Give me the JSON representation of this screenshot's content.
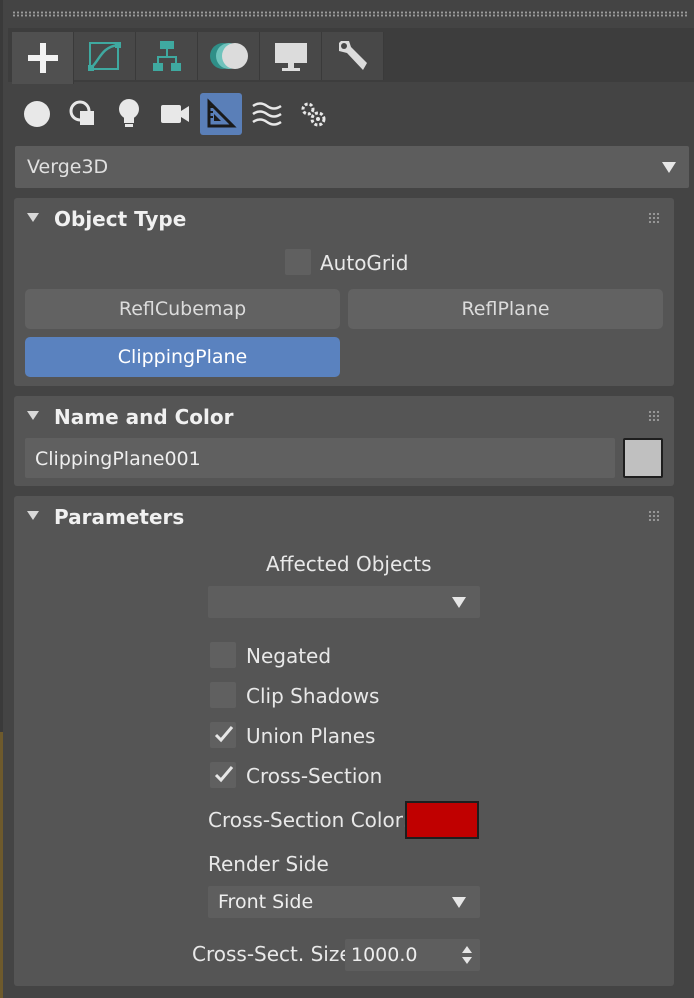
{
  "colors": {
    "accent": "#5a82bf",
    "cross_section_color": "#c00000",
    "name_swatch": "#c0c0c0"
  },
  "command_panel_tabs": [
    {
      "icon": "plus-icon",
      "name": "create"
    },
    {
      "icon": "curve-modify-icon",
      "name": "modify"
    },
    {
      "icon": "hierarchy-icon",
      "name": "hierarchy"
    },
    {
      "icon": "motion-icon",
      "name": "motion"
    },
    {
      "icon": "monitor-icon",
      "name": "display"
    },
    {
      "icon": "wrench-icon",
      "name": "utilities"
    }
  ],
  "create_categories": [
    {
      "icon": "sphere-icon",
      "name": "geometry"
    },
    {
      "icon": "shapes-icon",
      "name": "shapes"
    },
    {
      "icon": "lightbulb-icon",
      "name": "lights"
    },
    {
      "icon": "camera-icon",
      "name": "cameras"
    },
    {
      "icon": "helpers-ruler-icon",
      "name": "helpers",
      "active": true
    },
    {
      "icon": "space-warps-icon",
      "name": "space-warps"
    },
    {
      "icon": "systems-gears-icon",
      "name": "systems"
    }
  ],
  "category_select": {
    "value": "Verge3D"
  },
  "object_type": {
    "title": "Object Type",
    "autogrid_label": "AutoGrid",
    "autogrid_checked": false,
    "buttons": [
      {
        "label": "ReflCubemap",
        "active": false
      },
      {
        "label": "ReflPlane",
        "active": false
      },
      {
        "label": "ClippingPlane",
        "active": true
      }
    ]
  },
  "name_and_color": {
    "title": "Name and Color",
    "name_value": "ClippingPlane001"
  },
  "parameters": {
    "title": "Parameters",
    "affected_objects_label": "Affected Objects",
    "affected_objects_value": "",
    "checkboxes": [
      {
        "label": "Negated",
        "checked": false
      },
      {
        "label": "Clip Shadows",
        "checked": false
      },
      {
        "label": "Union Planes",
        "checked": true
      },
      {
        "label": "Cross-Section",
        "checked": true
      }
    ],
    "cross_section_color_label": "Cross-Section Color:",
    "render_side_label": "Render Side",
    "render_side_value": "Front Side",
    "cross_sect_size_label": "Cross-Sect. Size",
    "cross_sect_size_value": "1000.0"
  }
}
